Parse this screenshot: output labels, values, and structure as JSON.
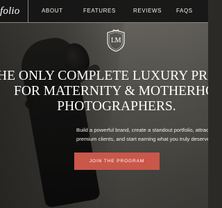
{
  "nav": {
    "brand": "folio",
    "links": [
      "ABOUT",
      "FEATURES",
      "REVIEWS",
      "FAQS"
    ]
  },
  "crest": {
    "monogram": "LM"
  },
  "hero": {
    "headline_lines": [
      "HE ONLY COMPLETE LUXURY PROG",
      "FOR MATERNITY & MOTHERHOO",
      "PHOTOGRAPHERS."
    ],
    "subtext_lines": [
      "Build a powerful brand, create a standout portfolio, attract",
      "premium clients, and start earning what you truly deserve."
    ],
    "cta_label": "JOIN THE PROGRAM"
  },
  "colors": {
    "nav_background": "#141413",
    "cta_background": "#c9574a",
    "text": "#ffffff"
  }
}
